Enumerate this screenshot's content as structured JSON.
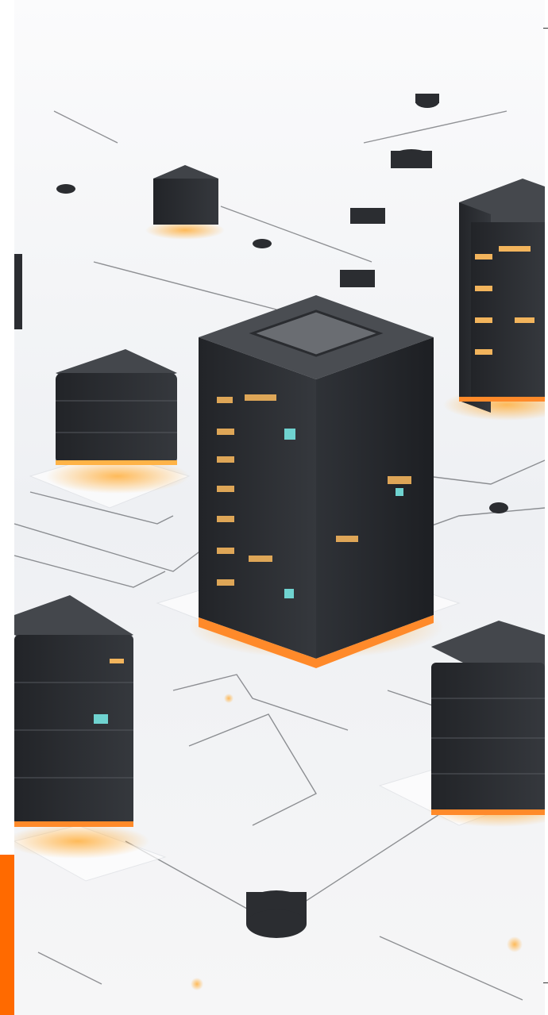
{
  "image": {
    "subject": "isometric-data-center-servers",
    "accent_color": "#ff6a00",
    "glow_color": "#ffb347",
    "server_color": "#2b2d31",
    "background_color": "#f4f5f7",
    "circuit_color": "#3a3d42"
  }
}
